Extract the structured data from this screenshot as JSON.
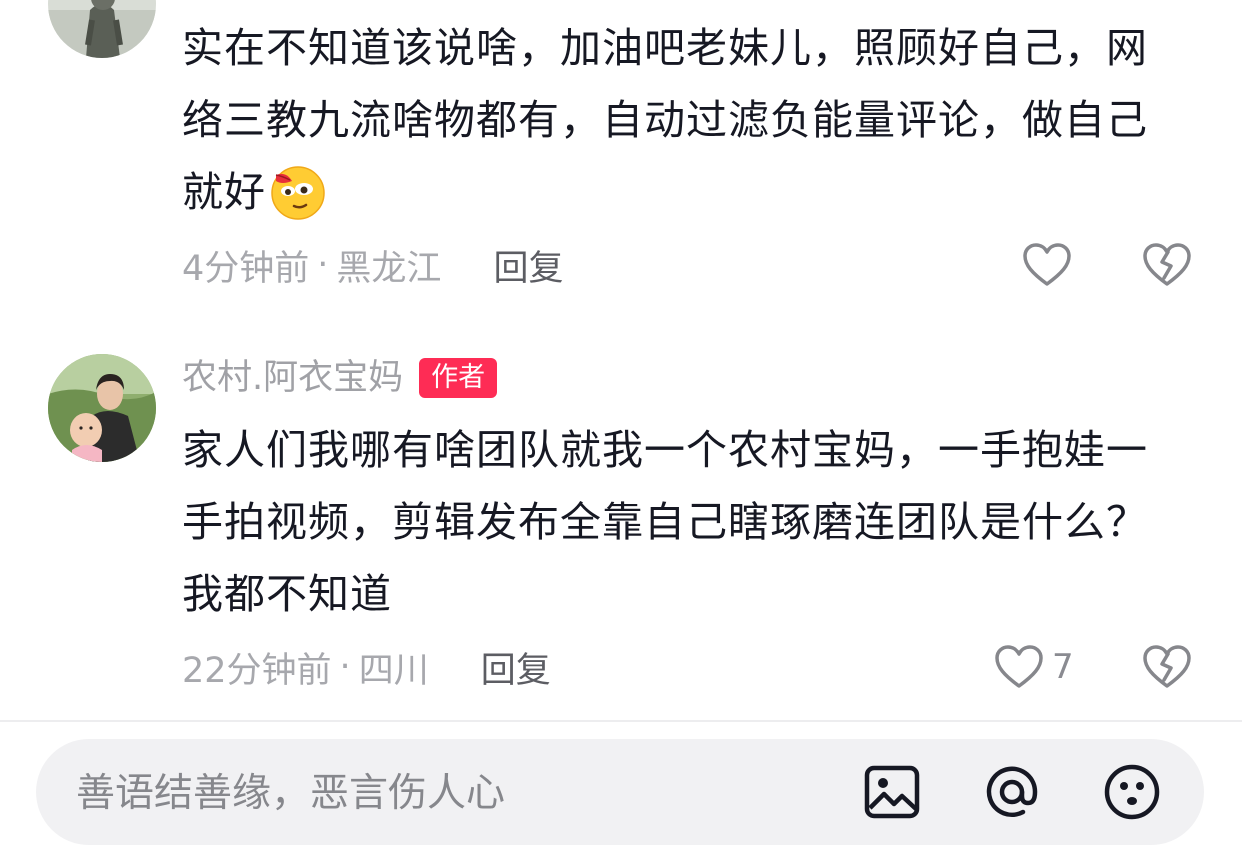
{
  "comments": [
    {
      "text": "实在不知道该说啥，加油吧老妹儿，照顾好自己，网络三教九流啥物都有，自动过滤负能量评论，做自己就好",
      "emoji_icon": "shy-face-emoji-icon",
      "time": "4分钟前",
      "separator": "·",
      "location": "黑龙江",
      "reply_label": "回复",
      "like_count": ""
    },
    {
      "username": "农村.阿衣宝妈",
      "badge": "作者",
      "text": "家人们我哪有啥团队就我一个农村宝妈，一手抱娃一手拍视频，剪辑发布全靠自己瞎琢磨连团队是什么？我都不知道",
      "time": "22分钟前",
      "separator": "·",
      "location": "四川",
      "reply_label": "回复",
      "like_count": "7"
    }
  ],
  "input_bar": {
    "placeholder": "善语结善缘，恶言伤人心",
    "icons": [
      "image-icon",
      "at-mention-icon",
      "emoji-icon"
    ]
  },
  "colors": {
    "badge": "#fe2c55",
    "text": "#161823",
    "muted": "#a7a8ad",
    "input_bg": "#f1f1f3"
  }
}
